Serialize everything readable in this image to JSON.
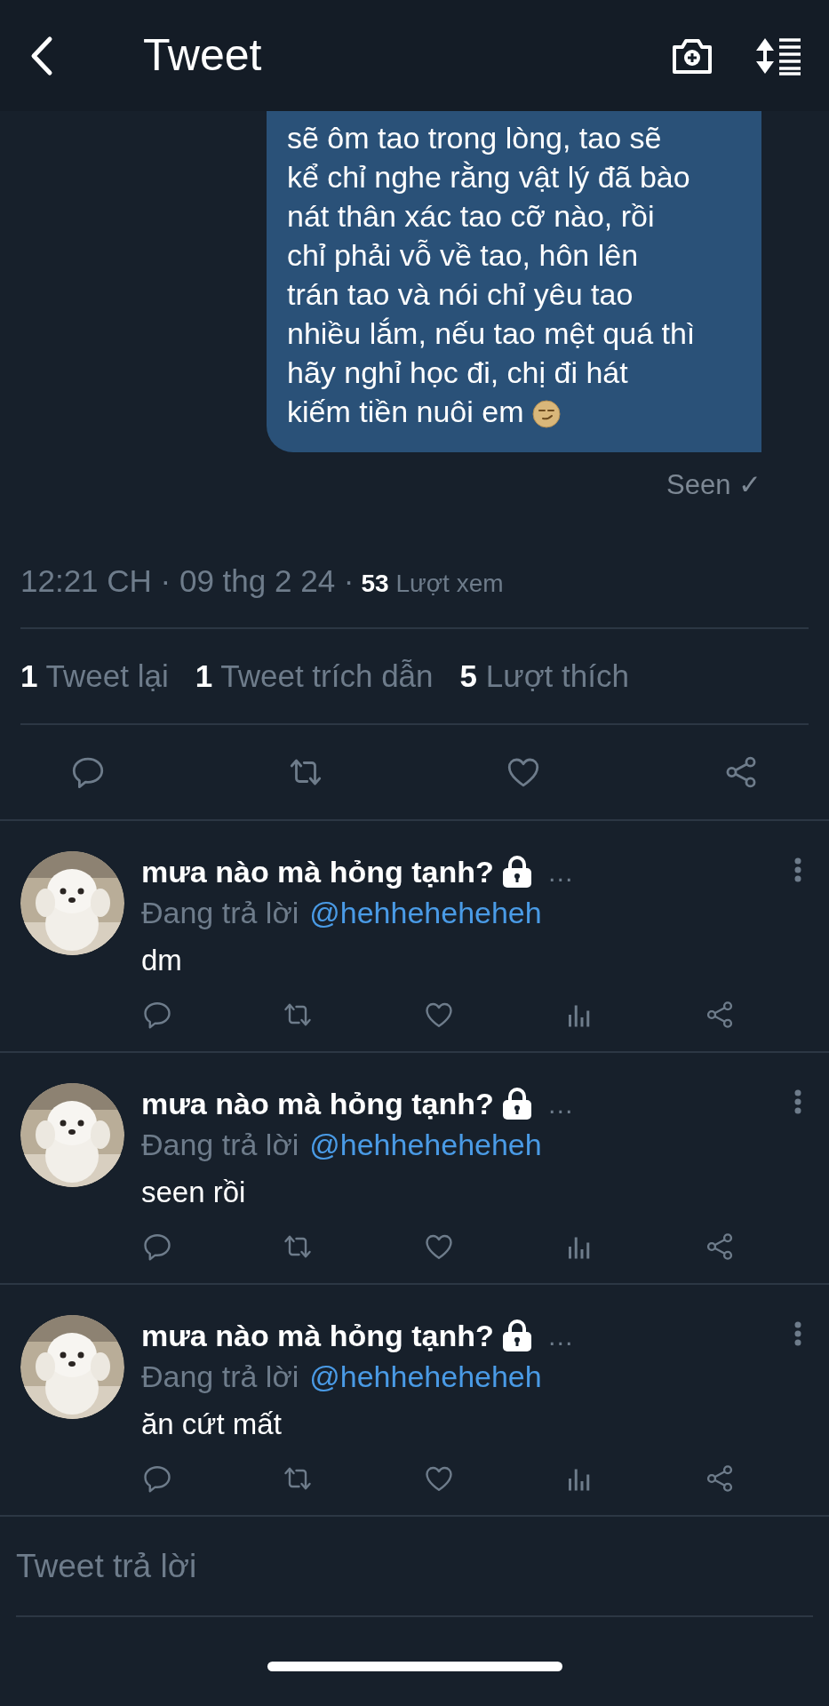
{
  "header": {
    "title": "Tweet"
  },
  "message": {
    "lines": [
      "sẽ ôm tao trong lòng, tao sẽ",
      "kể chỉ nghe rằng vật lý đã bào",
      "nát thân xác tao cỡ nào, rồi",
      "chỉ phải vỗ về tao, hôn lên",
      "trán tao và nói chỉ yêu tao",
      "nhiều lắm, nếu tao mệt quá thì",
      "hãy nghỉ học đi, chị đi hát",
      "kiếm tiền nuôi em"
    ],
    "status": "Seen ✓"
  },
  "timestamp": "12:21 CH · 09 thg 2 24 ·",
  "views": {
    "count": "53",
    "label": "Lượt xem"
  },
  "stats": [
    {
      "count": "1",
      "label": "Tweet lại"
    },
    {
      "count": "1",
      "label": "Tweet trích dẫn"
    },
    {
      "count": "5",
      "label": "Lượt thích"
    }
  ],
  "replies": [
    {
      "name": "mưa nào mà hỏng tạnh?",
      "locked": true,
      "more": "…",
      "replying_label": "Đang trả lời",
      "handle": "@hehheheheheh",
      "text": "dm"
    },
    {
      "name": "mưa nào mà hỏng tạnh?",
      "locked": true,
      "more": "…",
      "replying_label": "Đang trả lời",
      "handle": "@hehheheheheh",
      "text": "seen rồi"
    },
    {
      "name": "mưa nào mà hỏng tạnh?",
      "locked": true,
      "more": "…",
      "replying_label": "Đang trả lời",
      "handle": "@hehheheheheh",
      "text": "ăn cứt mất"
    }
  ],
  "reply_field": {
    "placeholder": "Tweet trả lời"
  }
}
